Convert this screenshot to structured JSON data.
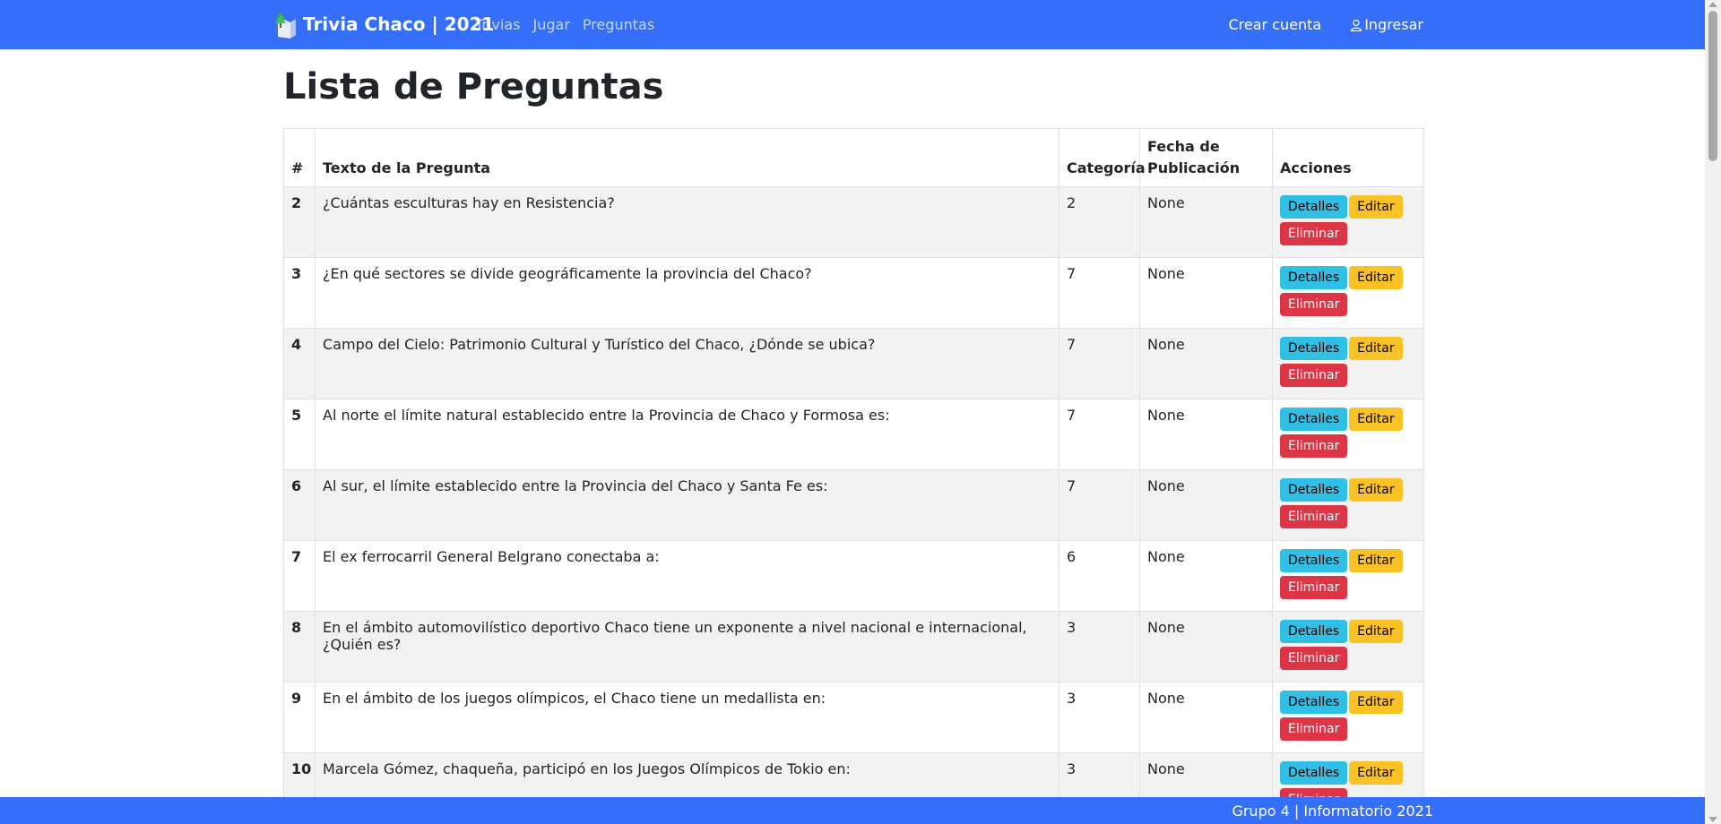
{
  "app": {
    "brand": "Trivia Chaco | 2021",
    "brand_icon": "book-tree-logo-icon",
    "nav": [
      {
        "label": "Trivias"
      },
      {
        "label": "Jugar"
      },
      {
        "label": "Preguntas"
      }
    ],
    "right_nav": [
      {
        "label": "Crear cuenta"
      },
      {
        "label": "Ingresar",
        "icon": "user-icon"
      }
    ],
    "accent": "#356ef8"
  },
  "page": {
    "title": "Lista de Preguntas"
  },
  "table": {
    "headers": [
      "#",
      "Texto de la Pregunta",
      "Categoría",
      "Fecha de Publicación",
      "Acciones"
    ],
    "rows": [
      {
        "id": "2",
        "text": "¿Cuántas esculturas hay en Resistencia?",
        "category": "2",
        "date": "None"
      },
      {
        "id": "3",
        "text": "¿En qué sectores se divide geográficamente la provincia del Chaco?",
        "category": "7",
        "date": "None"
      },
      {
        "id": "4",
        "text": "Campo del Cielo: Patrimonio Cultural y Turístico del Chaco, ¿Dónde se ubica?",
        "category": "7",
        "date": "None"
      },
      {
        "id": "5",
        "text": "Al norte el límite natural establecido entre la Provincia de Chaco y Formosa es:",
        "category": "7",
        "date": "None"
      },
      {
        "id": "6",
        "text": "Al sur, el límite establecido entre la Provincia del Chaco y Santa Fe es:",
        "category": "7",
        "date": "None"
      },
      {
        "id": "7",
        "text": "El ex ferrocarril General Belgrano conectaba a:",
        "category": "6",
        "date": "None"
      },
      {
        "id": "8",
        "text": "En el ámbito automovilístico deportivo Chaco tiene un exponente a nivel nacional e internacional, ¿Quién es?",
        "category": "3",
        "date": "None"
      },
      {
        "id": "9",
        "text": "En el ámbito de los juegos olímpicos, el Chaco tiene un medallista en:",
        "category": "3",
        "date": "None"
      },
      {
        "id": "10",
        "text": "Marcela Gómez, chaqueña, participó en los Juegos Olímpicos de Tokio en:",
        "category": "3",
        "date": "None"
      }
    ],
    "actions": {
      "details": "Detalles",
      "edit": "Editar",
      "delete": "Eliminar"
    },
    "action_colors": {
      "details": "#31c0e5",
      "edit": "#fbc225",
      "delete": "#dc3545"
    }
  },
  "footer": {
    "text": "Grupo 4 | Informatorio 2021"
  }
}
